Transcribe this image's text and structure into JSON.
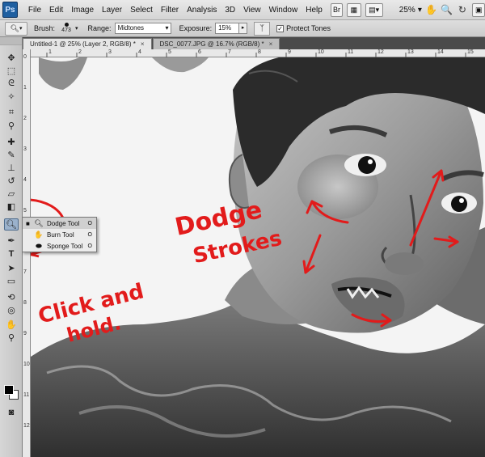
{
  "app": {
    "logo": "Ps"
  },
  "menu": {
    "items": [
      "File",
      "Edit",
      "Image",
      "Layer",
      "Select",
      "Filter",
      "Analysis",
      "3D",
      "View",
      "Window",
      "Help"
    ],
    "bridge_icon": "Br",
    "zoom": "25%"
  },
  "options": {
    "brush_label": "Brush:",
    "brush_size": "473",
    "range_label": "Range:",
    "range_value": "Midtones",
    "exposure_label": "Exposure:",
    "exposure_value": "15%",
    "protect_tones_label": "Protect Tones",
    "protect_tones_checked": true
  },
  "tabs": [
    {
      "label": "Untitled-1 @ 25% (Layer 2, RGB/8) *",
      "active": true
    },
    {
      "label": "DSC_0077.JPG @ 16.7% (RGB/8) *",
      "active": false
    }
  ],
  "ruler": {
    "top": [
      "1",
      "2",
      "3",
      "4",
      "5",
      "6",
      "7",
      "8",
      "9",
      "10",
      "11",
      "12",
      "13",
      "14",
      "15"
    ],
    "left": [
      "0",
      "1",
      "2",
      "3",
      "4",
      "5",
      "6",
      "7",
      "8",
      "9",
      "10",
      "11",
      "12"
    ]
  },
  "flyout": {
    "items": [
      {
        "label": "Dodge Tool",
        "key": "O",
        "icon": "dodge-icon",
        "active": true
      },
      {
        "label": "Burn Tool",
        "key": "O",
        "icon": "burn-icon",
        "active": false
      },
      {
        "label": "Sponge Tool",
        "key": "O",
        "icon": "sponge-icon",
        "active": false
      }
    ]
  },
  "annotations": {
    "dodge": "Dodge",
    "strokes": "Strokes",
    "click_and": "Click and",
    "hold": "hold."
  },
  "colors": {
    "annotation": "#e21b1b",
    "toolbox_active": "#9bb2cc",
    "ps_blue": "#1f5fa0"
  }
}
